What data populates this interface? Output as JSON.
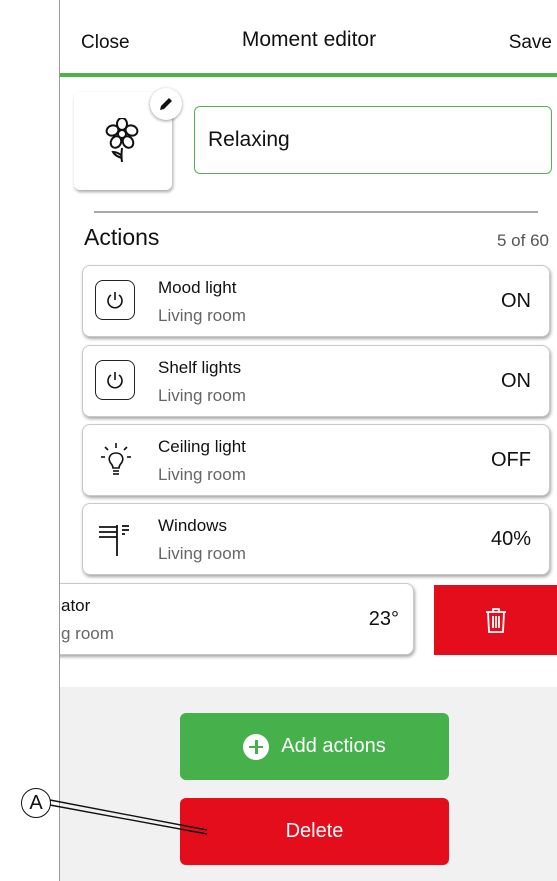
{
  "header": {
    "close_label": "Close",
    "title": "Moment editor",
    "save_label": "Save"
  },
  "moment": {
    "icon": "flower-icon",
    "edit_icon": "pencil-icon",
    "name_value": "Relaxing"
  },
  "actions": {
    "heading": "Actions",
    "count": "5 of 60",
    "items": [
      {
        "icon": "power-icon",
        "name": "Mood light",
        "room": "Living room",
        "value": "ON"
      },
      {
        "icon": "power-icon",
        "name": "Shelf lights",
        "room": "Living room",
        "value": "ON"
      },
      {
        "icon": "light-bulb-icon",
        "name": "Ceiling light",
        "room": "Living room",
        "value": "OFF"
      },
      {
        "icon": "blinds-icon",
        "name": "Windows",
        "room": "Living room",
        "value": "40%"
      }
    ],
    "swiped_item": {
      "name": "ator",
      "room": "g room",
      "value": "23°",
      "delete_icon": "trash-icon"
    }
  },
  "buttons": {
    "add_actions": "Add actions",
    "delete": "Delete"
  },
  "callout": {
    "label": "A"
  },
  "colors": {
    "accent_green": "#46b04a",
    "delete_red": "#e30d1c"
  }
}
